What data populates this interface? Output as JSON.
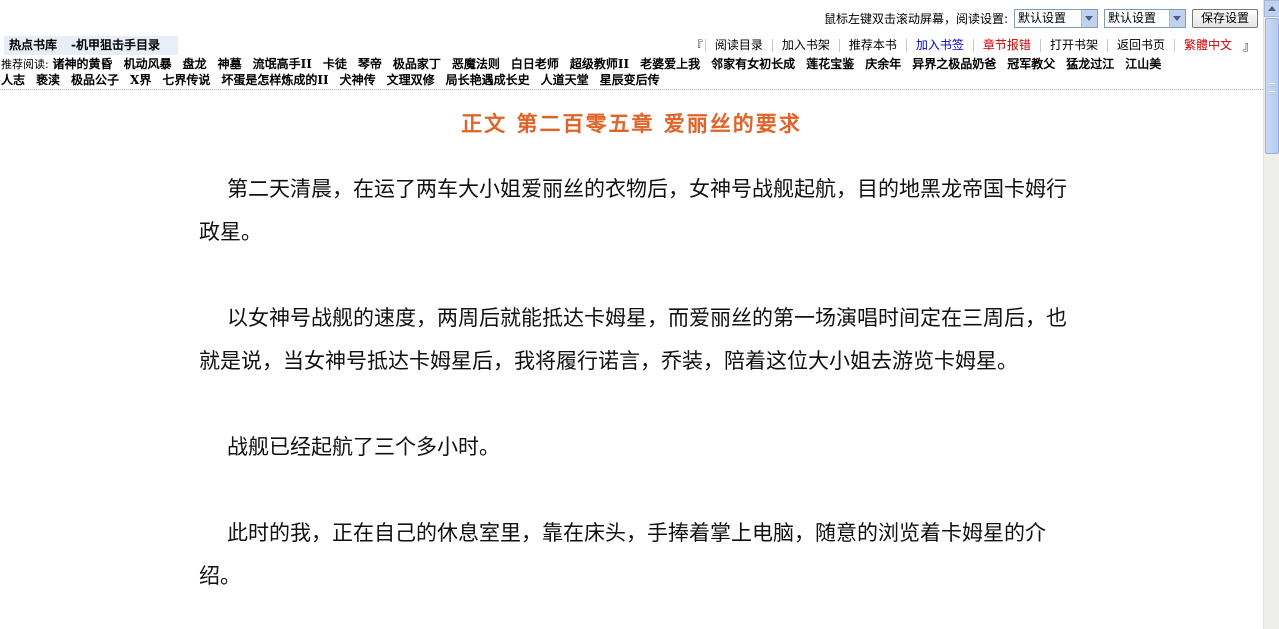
{
  "settings": {
    "hint": "鼠标左键双击滚动屏幕，阅读设置:",
    "select1_value": "默认设置",
    "select2_value": "默认设置",
    "save_label": "保存设置"
  },
  "hot_bar": {
    "label": "热点书库",
    "book": "-机甲狙击手目录"
  },
  "nav": {
    "open_bracket": "『",
    "close_bracket": "』",
    "links": [
      {
        "label": "阅读目录",
        "color": "#000000"
      },
      {
        "label": "加入书架",
        "color": "#000000"
      },
      {
        "label": "推荐本书",
        "color": "#000000"
      },
      {
        "label": "加入书签",
        "color": "#0000cc"
      },
      {
        "label": "章节报错",
        "color": "#cc0000"
      },
      {
        "label": "打开书架",
        "color": "#000000"
      },
      {
        "label": "返回书页",
        "color": "#000000"
      },
      {
        "label": "繁體中文",
        "color": "#cc0000"
      }
    ]
  },
  "recommend": {
    "prefix": "推荐阅读:",
    "line1": [
      "诸神的黄昏",
      "机动风暴",
      "盘龙",
      "神墓",
      "流氓高手II",
      "卡徒",
      "琴帝",
      "极品家丁",
      "恶魔法则",
      "白日老师",
      "超级教师II",
      "老婆爱上我",
      "邻家有女初长成",
      "莲花宝鉴",
      "庆余年",
      "异界之极品奶爸",
      "冠军教父",
      "猛龙过江",
      "江山美"
    ],
    "line2": [
      "人志",
      "亵渎",
      "极品公子",
      "X界",
      "七界传说",
      "坏蛋是怎样炼成的II",
      "犬神传",
      "文理双修",
      "局长艳遇成长史",
      "人道天堂",
      "星辰变后传"
    ]
  },
  "chapter": {
    "title": "正文 第二百零五章 爱丽丝的要求"
  },
  "content": {
    "paragraphs": [
      "第二天清晨，在运了两车大小姐爱丽丝的衣物后，女神号战舰起航，目的地黑龙帝国卡姆行政星。",
      "以女神号战舰的速度，两周后就能抵达卡姆星，而爱丽丝的第一场演唱时间定在三周后，也就是说，当女神号抵达卡姆星后，我将履行诺言，乔装，陪着这位大小姐去游览卡姆星。",
      "战舰已经起航了三个多小时。",
      "此时的我，正在自己的休息室里，靠在床头，手捧着掌上电脑，随意的浏览着卡姆星的介绍。"
    ]
  }
}
